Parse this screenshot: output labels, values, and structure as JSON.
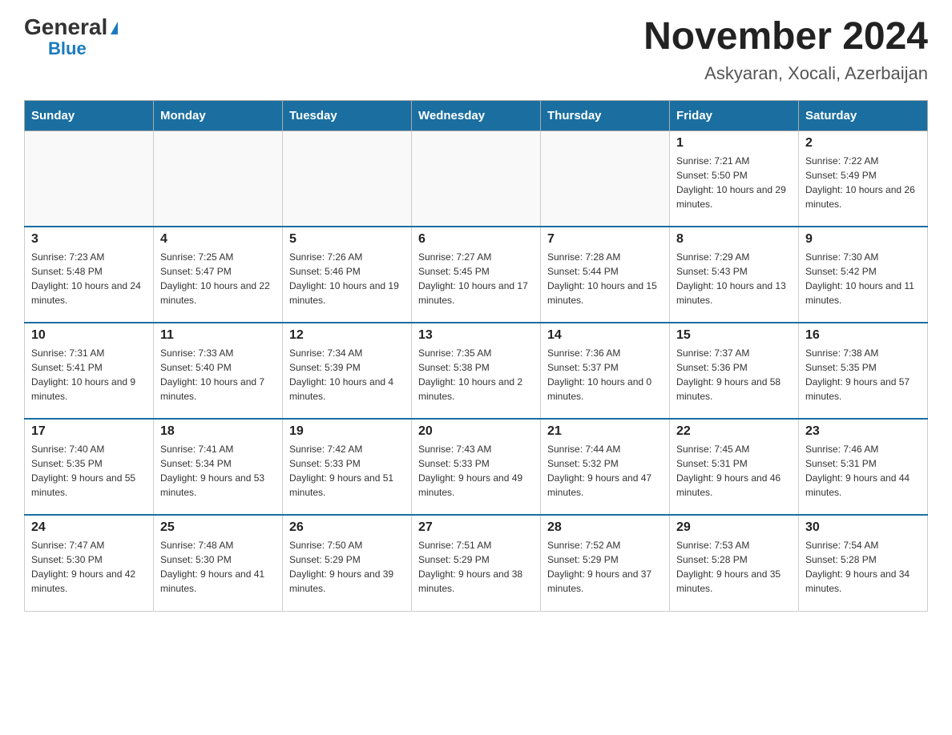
{
  "logo": {
    "general": "General",
    "triangle": "▶",
    "blue": "Blue"
  },
  "title": "November 2024",
  "subtitle": "Askyaran, Xocali, Azerbaijan",
  "days_of_week": [
    "Sunday",
    "Monday",
    "Tuesday",
    "Wednesday",
    "Thursday",
    "Friday",
    "Saturday"
  ],
  "weeks": [
    [
      {
        "day": "",
        "info": ""
      },
      {
        "day": "",
        "info": ""
      },
      {
        "day": "",
        "info": ""
      },
      {
        "day": "",
        "info": ""
      },
      {
        "day": "",
        "info": ""
      },
      {
        "day": "1",
        "info": "Sunrise: 7:21 AM\nSunset: 5:50 PM\nDaylight: 10 hours and 29 minutes."
      },
      {
        "day": "2",
        "info": "Sunrise: 7:22 AM\nSunset: 5:49 PM\nDaylight: 10 hours and 26 minutes."
      }
    ],
    [
      {
        "day": "3",
        "info": "Sunrise: 7:23 AM\nSunset: 5:48 PM\nDaylight: 10 hours and 24 minutes."
      },
      {
        "day": "4",
        "info": "Sunrise: 7:25 AM\nSunset: 5:47 PM\nDaylight: 10 hours and 22 minutes."
      },
      {
        "day": "5",
        "info": "Sunrise: 7:26 AM\nSunset: 5:46 PM\nDaylight: 10 hours and 19 minutes."
      },
      {
        "day": "6",
        "info": "Sunrise: 7:27 AM\nSunset: 5:45 PM\nDaylight: 10 hours and 17 minutes."
      },
      {
        "day": "7",
        "info": "Sunrise: 7:28 AM\nSunset: 5:44 PM\nDaylight: 10 hours and 15 minutes."
      },
      {
        "day": "8",
        "info": "Sunrise: 7:29 AM\nSunset: 5:43 PM\nDaylight: 10 hours and 13 minutes."
      },
      {
        "day": "9",
        "info": "Sunrise: 7:30 AM\nSunset: 5:42 PM\nDaylight: 10 hours and 11 minutes."
      }
    ],
    [
      {
        "day": "10",
        "info": "Sunrise: 7:31 AM\nSunset: 5:41 PM\nDaylight: 10 hours and 9 minutes."
      },
      {
        "day": "11",
        "info": "Sunrise: 7:33 AM\nSunset: 5:40 PM\nDaylight: 10 hours and 7 minutes."
      },
      {
        "day": "12",
        "info": "Sunrise: 7:34 AM\nSunset: 5:39 PM\nDaylight: 10 hours and 4 minutes."
      },
      {
        "day": "13",
        "info": "Sunrise: 7:35 AM\nSunset: 5:38 PM\nDaylight: 10 hours and 2 minutes."
      },
      {
        "day": "14",
        "info": "Sunrise: 7:36 AM\nSunset: 5:37 PM\nDaylight: 10 hours and 0 minutes."
      },
      {
        "day": "15",
        "info": "Sunrise: 7:37 AM\nSunset: 5:36 PM\nDaylight: 9 hours and 58 minutes."
      },
      {
        "day": "16",
        "info": "Sunrise: 7:38 AM\nSunset: 5:35 PM\nDaylight: 9 hours and 57 minutes."
      }
    ],
    [
      {
        "day": "17",
        "info": "Sunrise: 7:40 AM\nSunset: 5:35 PM\nDaylight: 9 hours and 55 minutes."
      },
      {
        "day": "18",
        "info": "Sunrise: 7:41 AM\nSunset: 5:34 PM\nDaylight: 9 hours and 53 minutes."
      },
      {
        "day": "19",
        "info": "Sunrise: 7:42 AM\nSunset: 5:33 PM\nDaylight: 9 hours and 51 minutes."
      },
      {
        "day": "20",
        "info": "Sunrise: 7:43 AM\nSunset: 5:33 PM\nDaylight: 9 hours and 49 minutes."
      },
      {
        "day": "21",
        "info": "Sunrise: 7:44 AM\nSunset: 5:32 PM\nDaylight: 9 hours and 47 minutes."
      },
      {
        "day": "22",
        "info": "Sunrise: 7:45 AM\nSunset: 5:31 PM\nDaylight: 9 hours and 46 minutes."
      },
      {
        "day": "23",
        "info": "Sunrise: 7:46 AM\nSunset: 5:31 PM\nDaylight: 9 hours and 44 minutes."
      }
    ],
    [
      {
        "day": "24",
        "info": "Sunrise: 7:47 AM\nSunset: 5:30 PM\nDaylight: 9 hours and 42 minutes."
      },
      {
        "day": "25",
        "info": "Sunrise: 7:48 AM\nSunset: 5:30 PM\nDaylight: 9 hours and 41 minutes."
      },
      {
        "day": "26",
        "info": "Sunrise: 7:50 AM\nSunset: 5:29 PM\nDaylight: 9 hours and 39 minutes."
      },
      {
        "day": "27",
        "info": "Sunrise: 7:51 AM\nSunset: 5:29 PM\nDaylight: 9 hours and 38 minutes."
      },
      {
        "day": "28",
        "info": "Sunrise: 7:52 AM\nSunset: 5:29 PM\nDaylight: 9 hours and 37 minutes."
      },
      {
        "day": "29",
        "info": "Sunrise: 7:53 AM\nSunset: 5:28 PM\nDaylight: 9 hours and 35 minutes."
      },
      {
        "day": "30",
        "info": "Sunrise: 7:54 AM\nSunset: 5:28 PM\nDaylight: 9 hours and 34 minutes."
      }
    ]
  ]
}
